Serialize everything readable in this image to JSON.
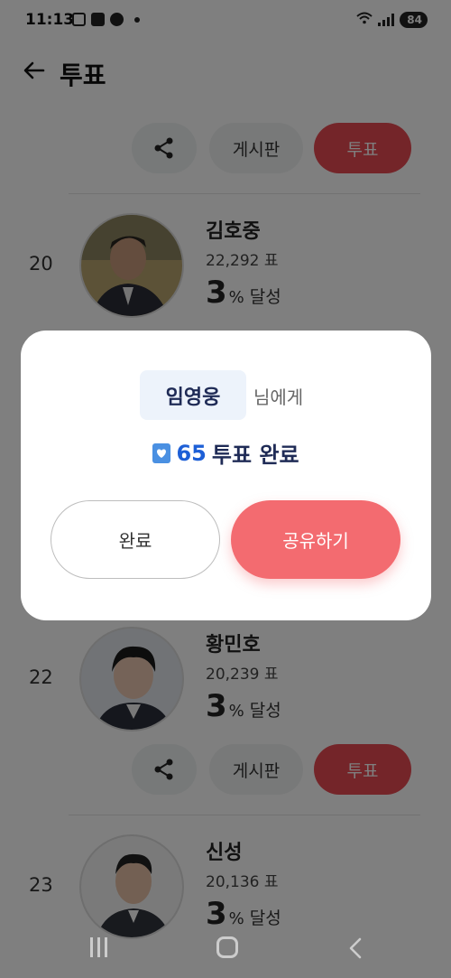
{
  "status_bar": {
    "time": "11:13",
    "battery": "84"
  },
  "header": {
    "title": "투표"
  },
  "actions": {
    "board_label": "게시판",
    "vote_label": "투표"
  },
  "ranking": [
    {
      "rank": "20",
      "name": "김호중",
      "votes": "22,292 표",
      "percent": "3",
      "percent_symbol": "%",
      "percent_label": "달성"
    },
    {
      "rank": "22",
      "name": "황민호",
      "votes": "20,239 표",
      "percent": "3",
      "percent_symbol": "%",
      "percent_label": "달성"
    },
    {
      "rank": "23",
      "name": "신성",
      "votes": "20,136 표",
      "percent": "3",
      "percent_symbol": "%",
      "percent_label": "달성"
    }
  ],
  "modal": {
    "recipient": "임영웅",
    "recipient_suffix": "님에게",
    "vote_count": "65",
    "result_label": "투표 완료",
    "done_label": "완료",
    "share_label": "공유하기"
  },
  "colors": {
    "vote_red": "#e94a52",
    "share_pink": "#f36b70",
    "result_blue": "#1d5fd6",
    "chip_bg": "#edf3fb"
  }
}
